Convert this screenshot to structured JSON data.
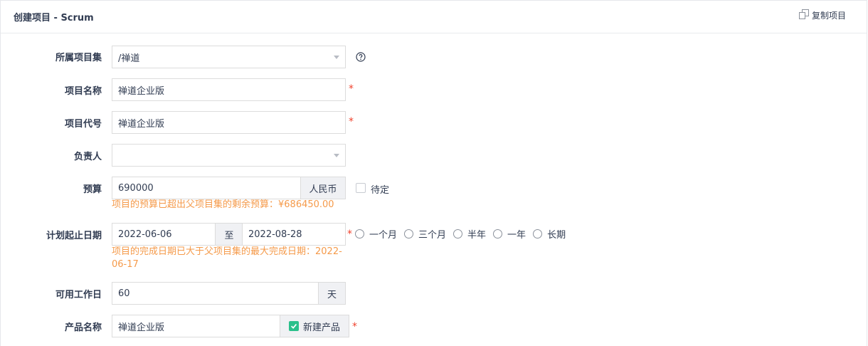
{
  "header": {
    "title": "创建项目 - Scrum",
    "copy_label": "复制项目"
  },
  "form": {
    "program": {
      "label": "所属项目集",
      "value": "/禅道"
    },
    "name": {
      "label": "项目名称",
      "value": "禅道企业版",
      "required": "*"
    },
    "code": {
      "label": "项目代号",
      "value": "禅道企业版",
      "required": "*"
    },
    "owner": {
      "label": "负责人",
      "value": ""
    },
    "budget": {
      "label": "预算",
      "value": "690000",
      "unit": "人民币",
      "pending_label": "待定",
      "warning": "项目的预算已超出父项目集的剩余预算：¥686450.00"
    },
    "dates": {
      "label": "计划起止日期",
      "begin": "2022-06-06",
      "separator": "至",
      "end": "2022-08-28",
      "required": "*",
      "warning_line1": "项目的完成日期已大于父项目集的最大完成日期：2022-",
      "warning_line2": "06-17",
      "options": [
        "一个月",
        "三个月",
        "半年",
        "一年",
        "长期"
      ]
    },
    "workdays": {
      "label": "可用工作日",
      "value": "60",
      "unit": "天"
    },
    "product": {
      "label": "产品名称",
      "value": "禅道企业版",
      "new_product_label": "新建产品",
      "required": "*"
    }
  },
  "colors": {
    "required": "#f0422d",
    "warning": "#f59a4a",
    "checkbox_checked": "#2ac08b"
  }
}
